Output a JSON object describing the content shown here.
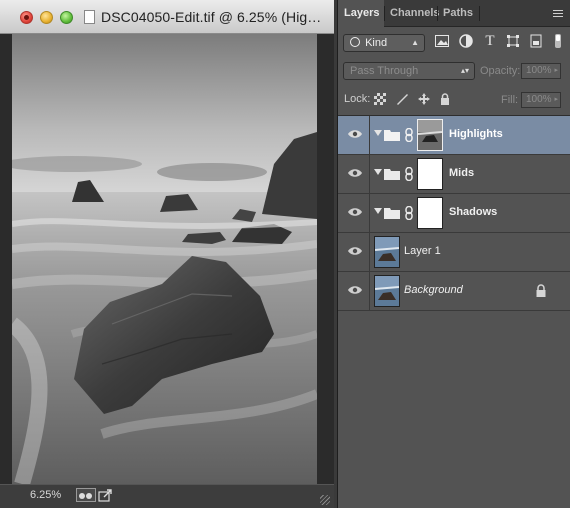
{
  "window": {
    "title": "DSC04050-Edit.tif @ 6.25% (Hig…",
    "zoom": "6.25%"
  },
  "panel": {
    "tabs": [
      {
        "label": "Layers",
        "active": true
      },
      {
        "label": "Channels",
        "active": false
      },
      {
        "label": "Paths",
        "active": false
      }
    ],
    "filter": {
      "kind_label": "Kind"
    },
    "blend_mode": "Pass Through",
    "opacity_label": "Opacity:",
    "opacity_value": "100%",
    "lock_label": "Lock:",
    "fill_label": "Fill:",
    "fill_value": "100%",
    "layers": [
      {
        "name": "Highlights",
        "type": "group",
        "selected": true,
        "italic": false
      },
      {
        "name": "Mids",
        "type": "group",
        "selected": false,
        "italic": false
      },
      {
        "name": "Shadows",
        "type": "group",
        "selected": false,
        "italic": false
      },
      {
        "name": "Layer 1",
        "type": "pixel",
        "selected": false,
        "italic": false
      },
      {
        "name": "Background",
        "type": "pixel",
        "selected": false,
        "italic": true,
        "locked": true
      }
    ]
  },
  "colors": {
    "panel_bg": "#535353",
    "selected_layer": "#7a8ca4",
    "tab_bar": "#3a3a3a"
  }
}
